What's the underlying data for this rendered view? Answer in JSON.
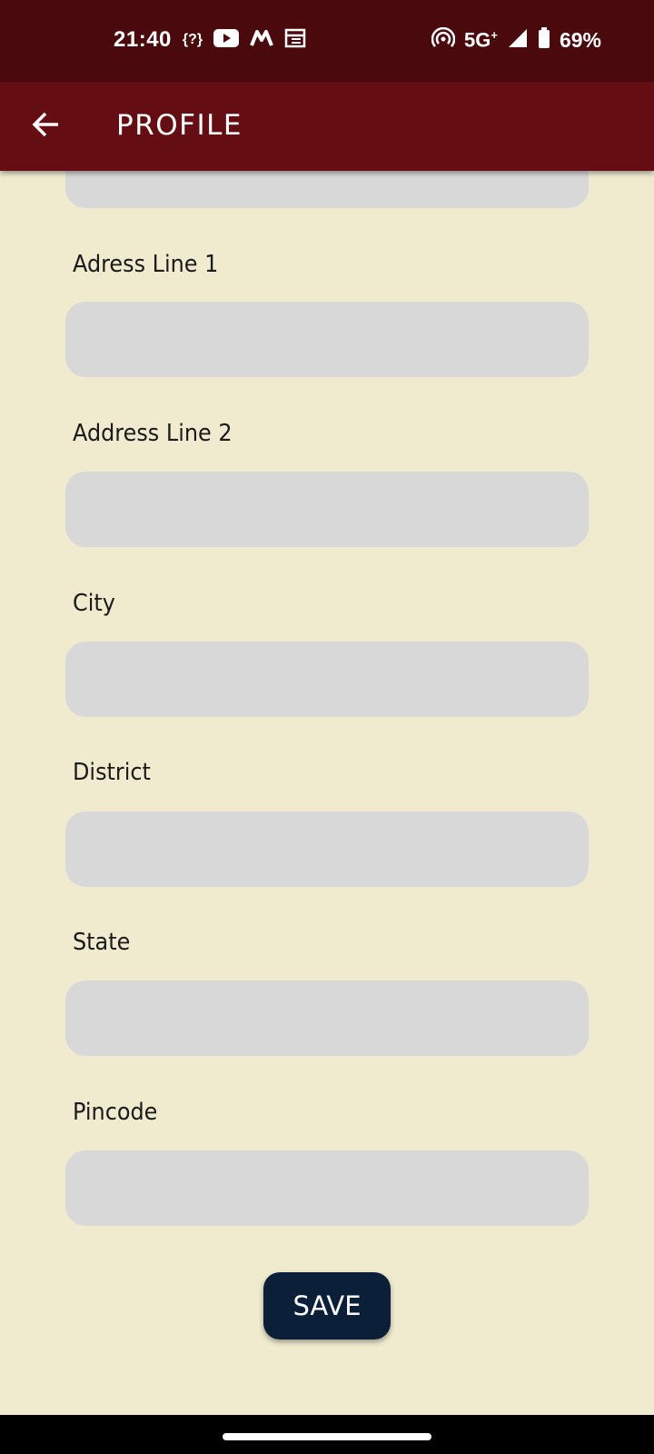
{
  "status_bar": {
    "time": "21:40",
    "curly_indicator": "{?}",
    "network": "5G",
    "battery": "69%",
    "icons": [
      "youtube-icon",
      "m-app-icon",
      "calendar-icon",
      "hotspot-icon",
      "signal-icon",
      "battery-icon"
    ]
  },
  "app_bar": {
    "title": "PROFILE",
    "back_icon": "arrow-left-icon",
    "color": "#640e13"
  },
  "form": {
    "fields": [
      {
        "label": "Adress Line 1",
        "value": ""
      },
      {
        "label": "Address Line 2",
        "value": ""
      },
      {
        "label": "City",
        "value": ""
      },
      {
        "label": "District",
        "value": ""
      },
      {
        "label": "State",
        "value": ""
      },
      {
        "label": "Pincode",
        "value": ""
      }
    ]
  },
  "save_button": {
    "label": "SAVE",
    "color": "#0b2038"
  },
  "colors": {
    "background": "#f0eacf",
    "status_bar": "#4a0a0d",
    "input_fill": "#d8d8d8"
  }
}
